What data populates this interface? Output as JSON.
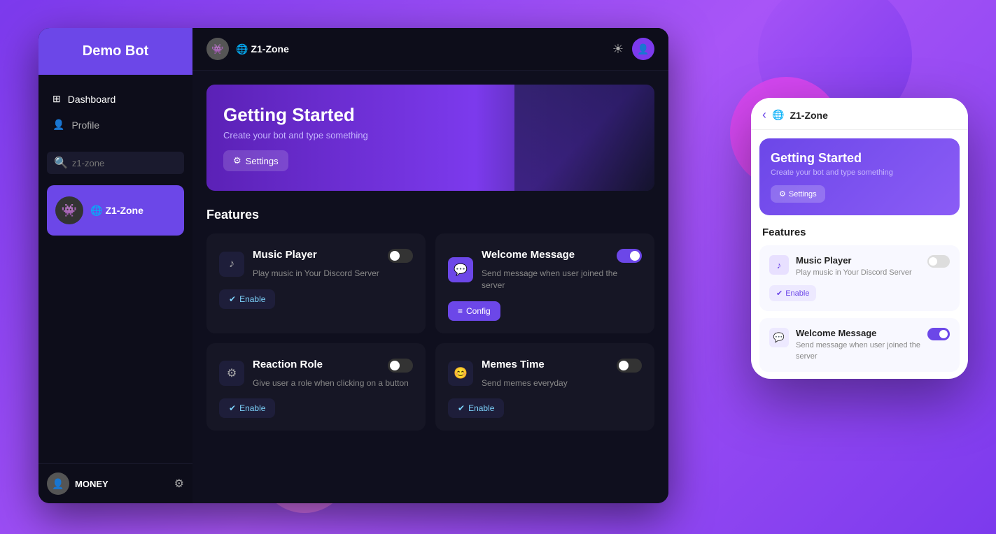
{
  "app": {
    "title": "Demo Bot",
    "theme_color": "#6c47e8"
  },
  "sidebar": {
    "title": "Demo Bot",
    "nav_items": [
      {
        "id": "dashboard",
        "label": "Dashboard",
        "icon": "⊞",
        "active": true
      },
      {
        "id": "profile",
        "label": "Profile",
        "icon": "👤",
        "active": false
      }
    ],
    "search_placeholder": "z1-zone",
    "server": {
      "name": "Z1-Zone",
      "icon": "🌐"
    },
    "footer": {
      "username": "MONEY",
      "gear_icon": "⚙"
    }
  },
  "topbar": {
    "server_name": "Z1-Zone",
    "server_icon": "🌐",
    "theme_icon": "☀",
    "user_avatar": "👤"
  },
  "banner": {
    "title": "Getting Started",
    "subtitle": "Create your bot and type something",
    "settings_label": "Settings",
    "settings_icon": "⚙"
  },
  "features": {
    "section_title": "Features",
    "items": [
      {
        "id": "music-player",
        "name": "Music Player",
        "description": "Play music in Your Discord Server",
        "icon": "♪",
        "icon_style": "normal",
        "enabled": false,
        "button_label": "Enable",
        "button_icon": "✔",
        "button_type": "enable"
      },
      {
        "id": "welcome-message",
        "name": "Welcome Message",
        "description": "Send message when user joined the server",
        "icon": "💬",
        "icon_style": "purple",
        "enabled": true,
        "button_label": "Config",
        "button_icon": "≡",
        "button_type": "config"
      },
      {
        "id": "reaction-role",
        "name": "Reaction Role",
        "description": "Give user a role when clicking on a button",
        "icon": "⚙",
        "icon_style": "normal",
        "enabled": false,
        "button_label": "Enable",
        "button_icon": "✔",
        "button_type": "enable"
      },
      {
        "id": "memes-time",
        "name": "Memes Time",
        "description": "Send memes everyday",
        "icon": "😊",
        "icon_style": "normal",
        "enabled": false,
        "button_label": "Enable",
        "button_icon": "✔",
        "button_type": "enable"
      }
    ]
  },
  "mobile": {
    "back_icon": "‹",
    "server_name": "Z1-Zone",
    "banner": {
      "title": "Getting Started",
      "subtitle": "Create your bot and type something",
      "settings_label": "Settings",
      "settings_icon": "⚙"
    },
    "features_title": "Features",
    "features": [
      {
        "id": "music-player",
        "name": "Music Player",
        "description": "Play music in Your Discord Server",
        "icon": "♪",
        "enabled": false,
        "enable_label": "Enable",
        "enable_icon": "✔"
      },
      {
        "id": "welcome-message",
        "name": "Welcome Message",
        "description": "Send message when user joined the server",
        "icon": "💬",
        "enabled": true
      }
    ]
  }
}
